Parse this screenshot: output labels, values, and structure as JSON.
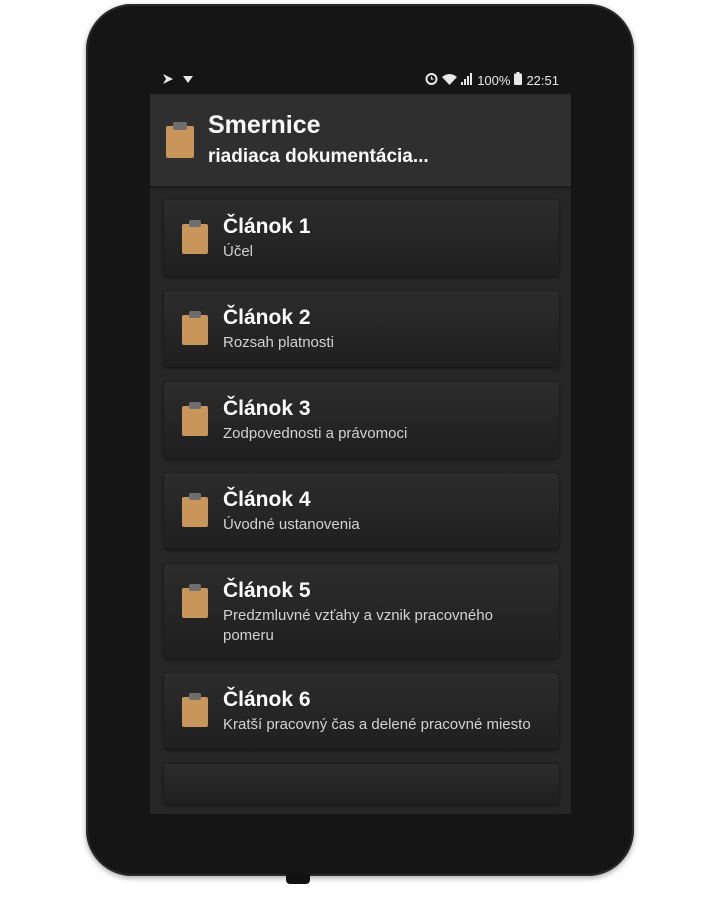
{
  "status_bar": {
    "battery_percent": "100%",
    "time": "22:51",
    "left_icons": [
      "navigation-icon",
      "download-icon"
    ],
    "right_icons": [
      "alarm-icon",
      "wifi-icon",
      "signal-icon",
      "battery-icon"
    ]
  },
  "app_bar": {
    "icon": "clipboard-icon",
    "title": "Smernice",
    "subtitle": "riadiaca dokumentácia..."
  },
  "articles": [
    {
      "title": "Článok 1",
      "subtitle": "Účel"
    },
    {
      "title": "Článok 2",
      "subtitle": "Rozsah platnosti"
    },
    {
      "title": "Článok 3",
      "subtitle": "Zodpovednosti a právomoci"
    },
    {
      "title": "Článok 4",
      "subtitle": "Úvodné ustanovenia"
    },
    {
      "title": "Článok 5",
      "subtitle": "Predzmluvné vzťahy a vznik pracovného pomeru"
    },
    {
      "title": "Článok 6",
      "subtitle": "Kratší pracovný čas a delené pracovné miesto"
    }
  ],
  "colors": {
    "clipboard": "#c8955a",
    "clipboard_clip": "#6e6e6e",
    "screen_bg": "#262626",
    "device": "#151515"
  }
}
